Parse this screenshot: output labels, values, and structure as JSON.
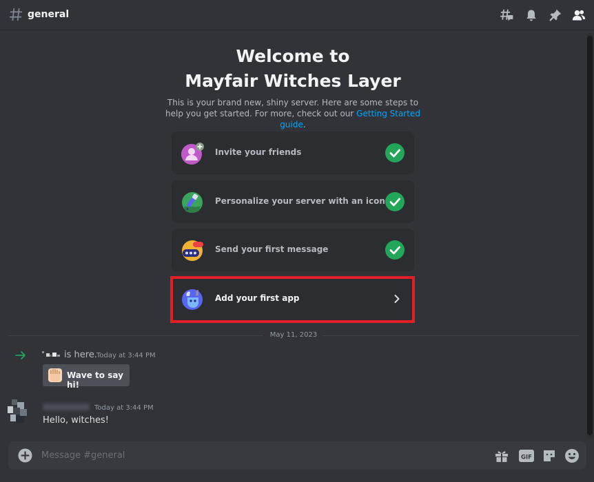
{
  "channel": {
    "name": "general"
  },
  "welcome": {
    "title_line1": "Welcome to",
    "title_line2": "Mayfair Witches Layer",
    "subtitle_pre": "This is your brand new, shiny server. Here are some steps to help you get started. For more, check out our ",
    "subtitle_link": "Getting Started guide",
    "subtitle_post": "."
  },
  "checklist": [
    {
      "label": "Invite your friends",
      "done": true,
      "icon": "invite-friends-icon"
    },
    {
      "label": "Personalize your server with an icon",
      "done": true,
      "icon": "personalize-icon"
    },
    {
      "label": "Send your first message",
      "done": true,
      "icon": "message-icon"
    },
    {
      "label": "Add your first app",
      "done": false,
      "icon": "app-icon"
    }
  ],
  "divider": {
    "date": "May 11, 2023"
  },
  "messages": [
    {
      "type": "join",
      "text": "is here.",
      "timestamp": "Today at 3:44 PM",
      "action": "Wave to say hi!"
    },
    {
      "type": "message",
      "timestamp": "Today at 3:44 PM",
      "text": "Hello, witches!"
    }
  ],
  "composer": {
    "placeholder": "Message #general"
  },
  "colors": {
    "accent_green": "#23a55a",
    "link": "#00a8fc",
    "highlight": "#e31e24",
    "background": "#313338"
  }
}
